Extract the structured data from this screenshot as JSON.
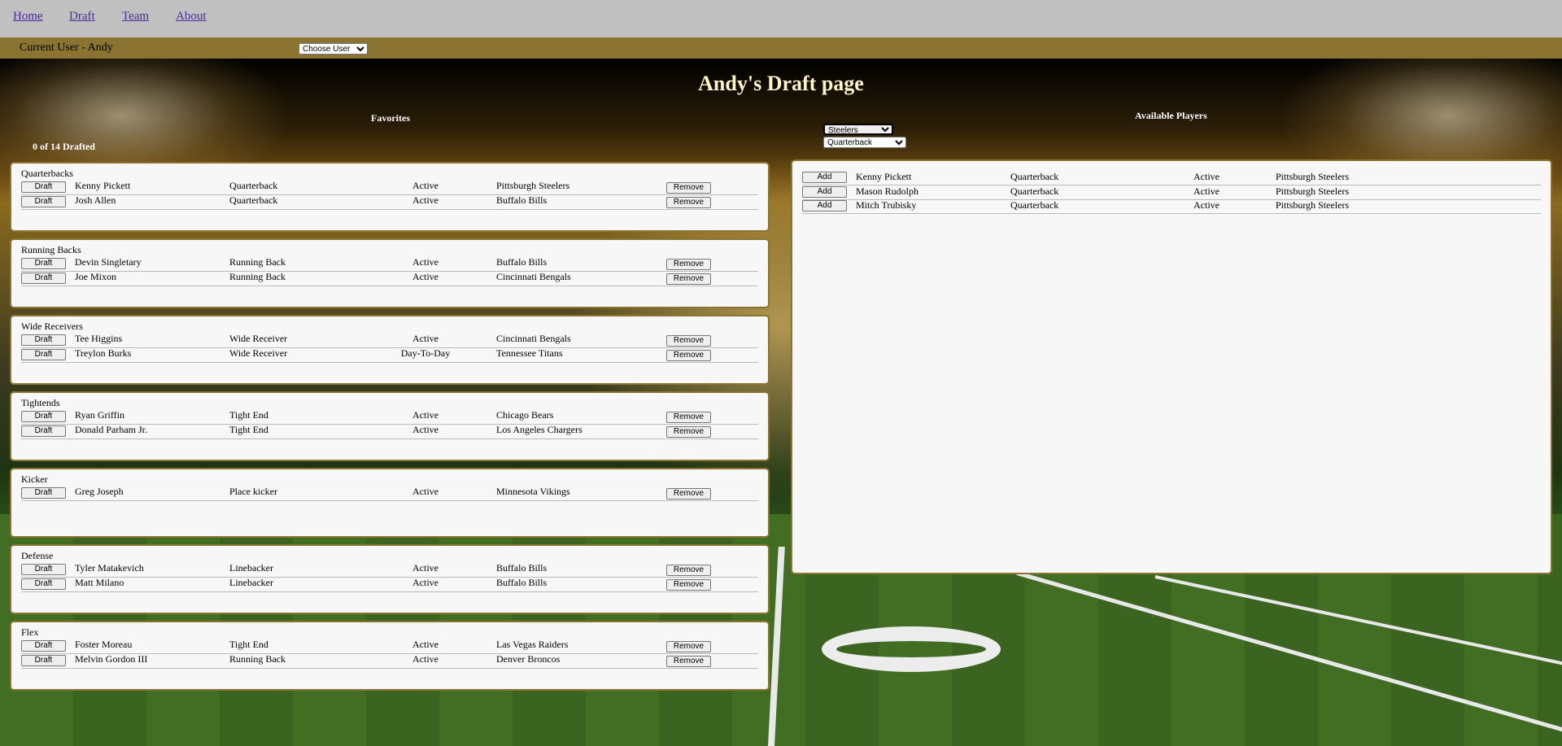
{
  "nav": {
    "home": "Home",
    "draft": "Draft",
    "team": "Team",
    "about": "About"
  },
  "userbar": {
    "current_user": "Current User - Andy",
    "choose_user": "Choose User"
  },
  "page": {
    "title": "Andy's Draft page",
    "favorites_label": "Favorites",
    "available_label": "Available Players",
    "drafted_count": "0 of 14 Drafted"
  },
  "filters": {
    "team": "Steelers",
    "position": "Quarterback"
  },
  "buttons": {
    "draft": "Draft",
    "remove": "Remove",
    "add": "Add"
  },
  "groups": [
    {
      "name": "Quarterbacks",
      "players": [
        {
          "name": "Kenny Pickett",
          "position": "Quarterback",
          "status": "Active",
          "team": "Pittsburgh Steelers"
        },
        {
          "name": "Josh Allen",
          "position": "Quarterback",
          "status": "Active",
          "team": "Buffalo Bills"
        }
      ]
    },
    {
      "name": "Running Backs",
      "players": [
        {
          "name": "Devin Singletary",
          "position": "Running Back",
          "status": "Active",
          "team": "Buffalo Bills"
        },
        {
          "name": "Joe Mixon",
          "position": "Running Back",
          "status": "Active",
          "team": "Cincinnati Bengals"
        }
      ]
    },
    {
      "name": "Wide Receivers",
      "players": [
        {
          "name": "Tee Higgins",
          "position": "Wide Receiver",
          "status": "Active",
          "team": "Cincinnati Bengals"
        },
        {
          "name": "Treylon Burks",
          "position": "Wide Receiver",
          "status": "Day-To-Day",
          "team": "Tennessee Titans"
        }
      ]
    },
    {
      "name": "Tightends",
      "players": [
        {
          "name": "Ryan Griffin",
          "position": "Tight End",
          "status": "Active",
          "team": "Chicago Bears"
        },
        {
          "name": "Donald Parham Jr.",
          "position": "Tight End",
          "status": "Active",
          "team": "Los Angeles Chargers"
        }
      ]
    },
    {
      "name": "Kicker",
      "players": [
        {
          "name": "Greg Joseph",
          "position": "Place kicker",
          "status": "Active",
          "team": "Minnesota Vikings"
        }
      ]
    },
    {
      "name": "Defense",
      "players": [
        {
          "name": "Tyler Matakevich",
          "position": "Linebacker",
          "status": "Active",
          "team": "Buffalo Bills"
        },
        {
          "name": "Matt Milano",
          "position": "Linebacker",
          "status": "Active",
          "team": "Buffalo Bills"
        }
      ]
    },
    {
      "name": "Flex",
      "players": [
        {
          "name": "Foster Moreau",
          "position": "Tight End",
          "status": "Active",
          "team": "Las Vegas Raiders"
        },
        {
          "name": "Melvin Gordon III",
          "position": "Running Back",
          "status": "Active",
          "team": "Denver Broncos"
        }
      ]
    }
  ],
  "available": [
    {
      "name": "Kenny Pickett",
      "position": "Quarterback",
      "status": "Active",
      "team": "Pittsburgh Steelers"
    },
    {
      "name": "Mason Rudolph",
      "position": "Quarterback",
      "status": "Active",
      "team": "Pittsburgh Steelers"
    },
    {
      "name": "Mitch Trubisky",
      "position": "Quarterback",
      "status": "Active",
      "team": "Pittsburgh Steelers"
    }
  ]
}
